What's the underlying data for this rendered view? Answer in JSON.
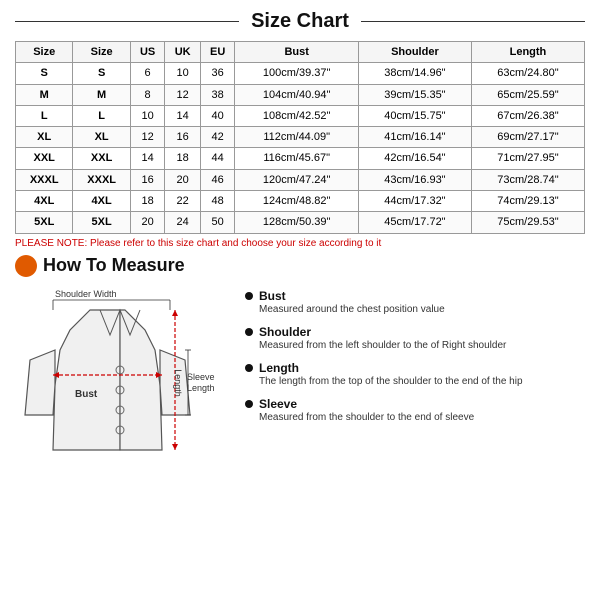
{
  "title": "Size Chart",
  "table": {
    "headers": [
      "Size",
      "Size",
      "US",
      "UK",
      "EU",
      "Bust",
      "Shoulder",
      "Length"
    ],
    "rows": [
      [
        "S",
        "S",
        "6",
        "10",
        "36",
        "100cm/39.37\"",
        "38cm/14.96\"",
        "63cm/24.80\""
      ],
      [
        "M",
        "M",
        "8",
        "12",
        "38",
        "104cm/40.94\"",
        "39cm/15.35\"",
        "65cm/25.59\""
      ],
      [
        "L",
        "L",
        "10",
        "14",
        "40",
        "108cm/42.52\"",
        "40cm/15.75\"",
        "67cm/26.38\""
      ],
      [
        "XL",
        "XL",
        "12",
        "16",
        "42",
        "112cm/44.09\"",
        "41cm/16.14\"",
        "69cm/27.17\""
      ],
      [
        "XXL",
        "XXL",
        "14",
        "18",
        "44",
        "116cm/45.67\"",
        "42cm/16.54\"",
        "71cm/27.95\""
      ],
      [
        "XXXL",
        "XXXL",
        "16",
        "20",
        "46",
        "120cm/47.24\"",
        "43cm/16.93\"",
        "73cm/28.74\""
      ],
      [
        "4XL",
        "4XL",
        "18",
        "22",
        "48",
        "124cm/48.82\"",
        "44cm/17.32\"",
        "74cm/29.13\""
      ],
      [
        "5XL",
        "5XL",
        "20",
        "24",
        "50",
        "128cm/50.39\"",
        "45cm/17.72\"",
        "75cm/29.53\""
      ]
    ]
  },
  "note": "PLEASE NOTE: Please refer to this size chart and choose your size according to it",
  "how_to_measure": {
    "title": "How To Measure",
    "items": [
      {
        "title": "Bust",
        "desc": "Measured around the chest position value"
      },
      {
        "title": "Shoulder",
        "desc": "Measured from the left shoulder to the of Right shoulder"
      },
      {
        "title": "Length",
        "desc": "The length from the top of the shoulder to the end of the hip"
      },
      {
        "title": "Sleeve",
        "desc": "Measured from the shoulder to the end of sleeve"
      }
    ]
  },
  "jacket_labels": {
    "shoulder_width": "Shoulder Width",
    "bust": "Bust",
    "sleeve_length": "Sleeve\nLength",
    "length": "Length"
  }
}
